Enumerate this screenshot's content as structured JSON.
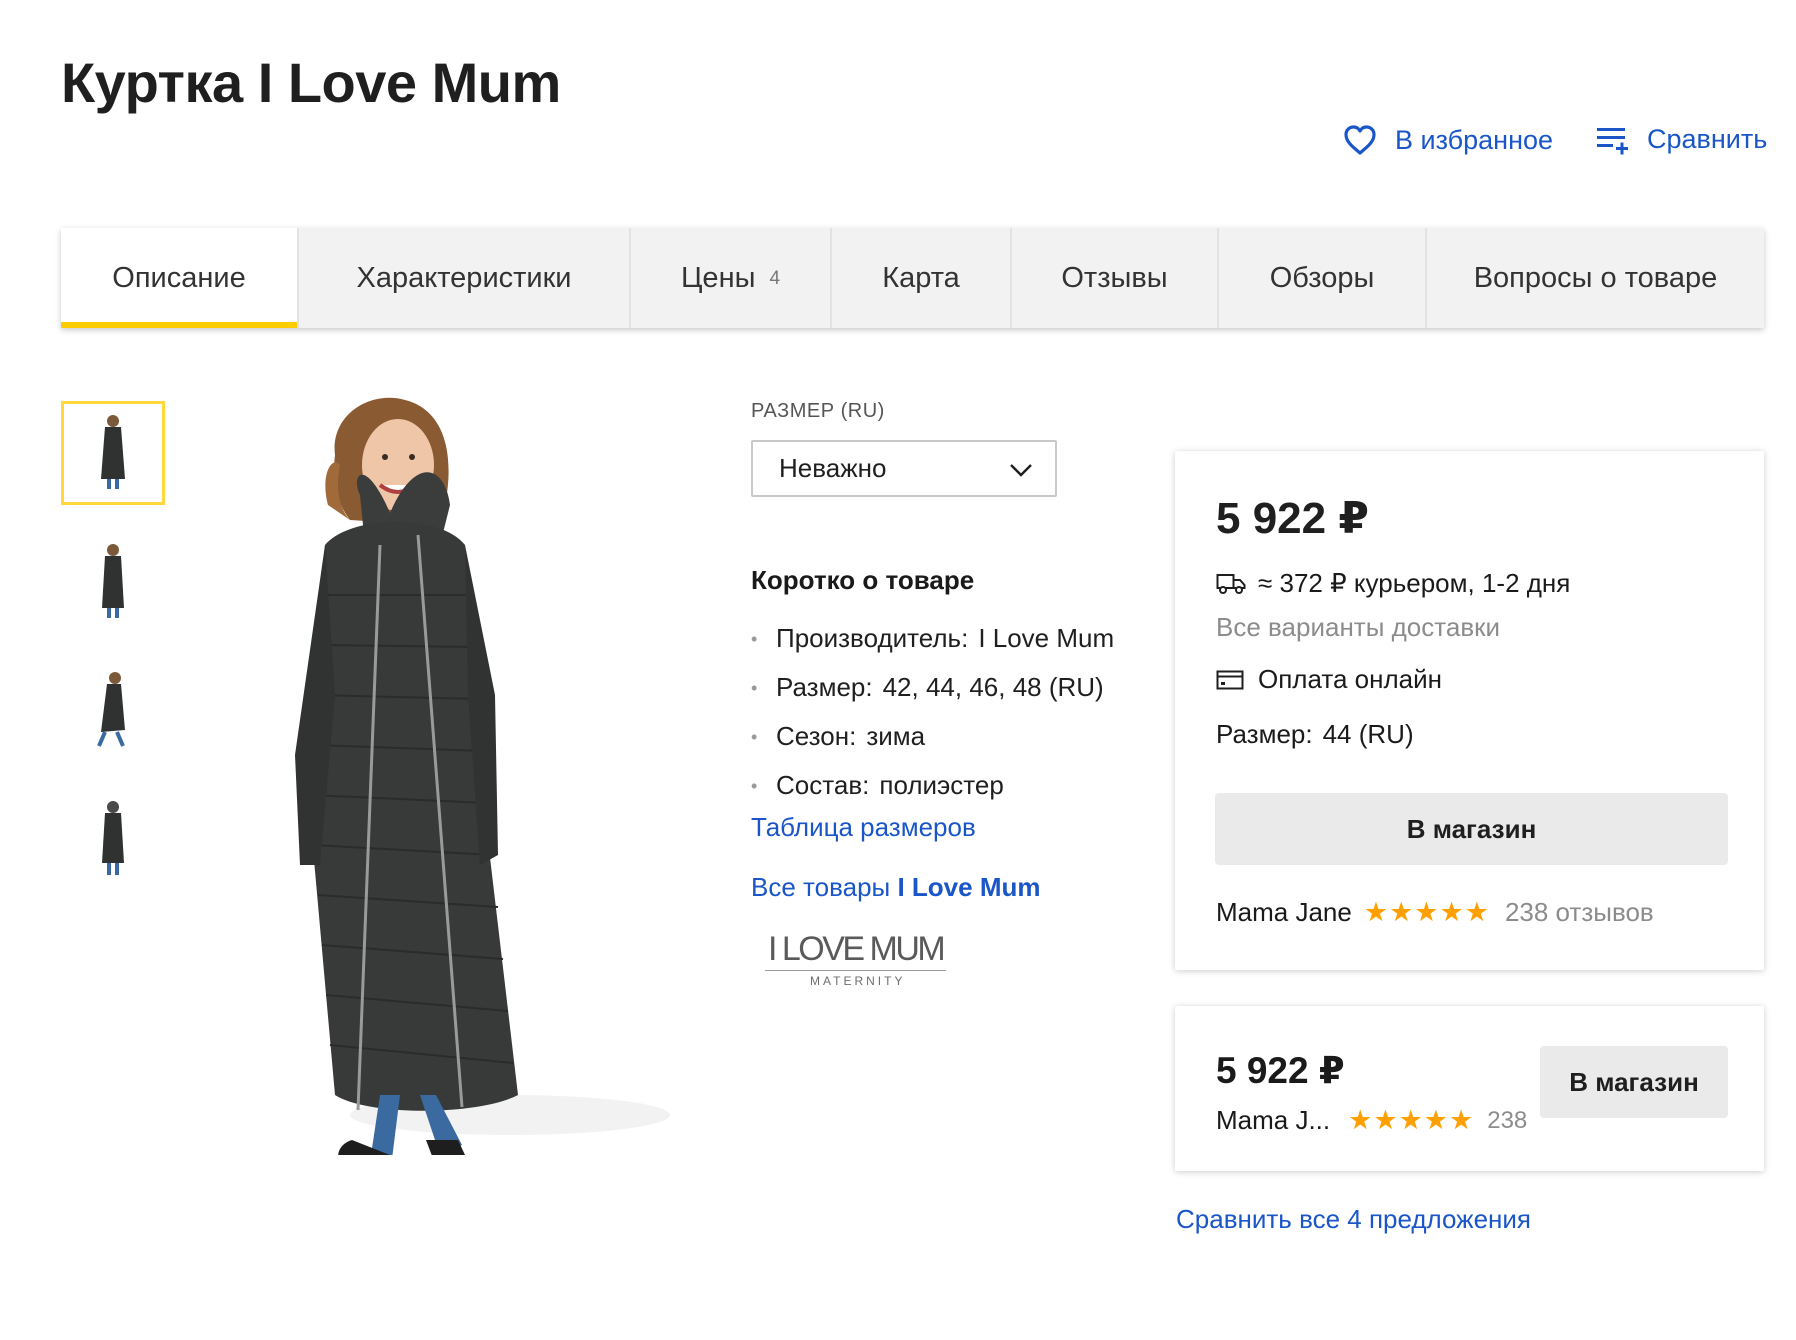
{
  "product": {
    "title": "Куртка I Love Mum"
  },
  "actions": {
    "favorite_label": "В избранное",
    "compare_label": "Сравнить"
  },
  "tabs": [
    {
      "label": "Описание",
      "count": ""
    },
    {
      "label": "Характеристики",
      "count": ""
    },
    {
      "label": "Цены",
      "count": "4"
    },
    {
      "label": "Карта",
      "count": ""
    },
    {
      "label": "Отзывы",
      "count": ""
    },
    {
      "label": "Обзоры",
      "count": ""
    },
    {
      "label": "Вопросы о товаре",
      "count": ""
    }
  ],
  "active_tab": "Описание",
  "gallery": {
    "thumbnail_count": 4,
    "selected_index": 0
  },
  "size_selector": {
    "label": "РАЗМЕР (RU)",
    "value": "Неважно"
  },
  "short_info": {
    "title": "Коротко о товаре",
    "specs": [
      {
        "key": "Производитель:",
        "value": "I Love Mum"
      },
      {
        "key": "Размер:",
        "value": "42, 44, 46, 48 (RU)"
      },
      {
        "key": "Сезон:",
        "value": "зима"
      },
      {
        "key": "Состав:",
        "value": "полиэстер"
      }
    ],
    "size_table_link": "Таблица размеров",
    "all_goods_prefix": "Все товары",
    "all_goods_brand": "I Love Mum"
  },
  "brand_logo": {
    "name": "I LOVE MUM",
    "subtitle": "MATERNITY"
  },
  "offer_main": {
    "price": "5 922 ₽",
    "delivery": "≈ 372 ₽ курьером, 1-2 дня",
    "all_delivery_link": "Все варианты доставки",
    "payment": "Оплата онлайн",
    "size_label": "Размер:",
    "size_value": "44 (RU)",
    "button_label": "В магазин",
    "shop_name": "Mama Jane",
    "rating": 5,
    "reviews": "238 отзывов"
  },
  "offer_second": {
    "price": "5 922 ₽",
    "shop_name": "Mama J...",
    "rating": 5,
    "reviews": "238",
    "button_label": "В магазин"
  },
  "compare_all_link": "Сравнить все 4 предложения",
  "colors": {
    "accent_yellow": "#ffcc00",
    "link_blue": "#1a56c8",
    "star_orange": "#ffa000"
  }
}
